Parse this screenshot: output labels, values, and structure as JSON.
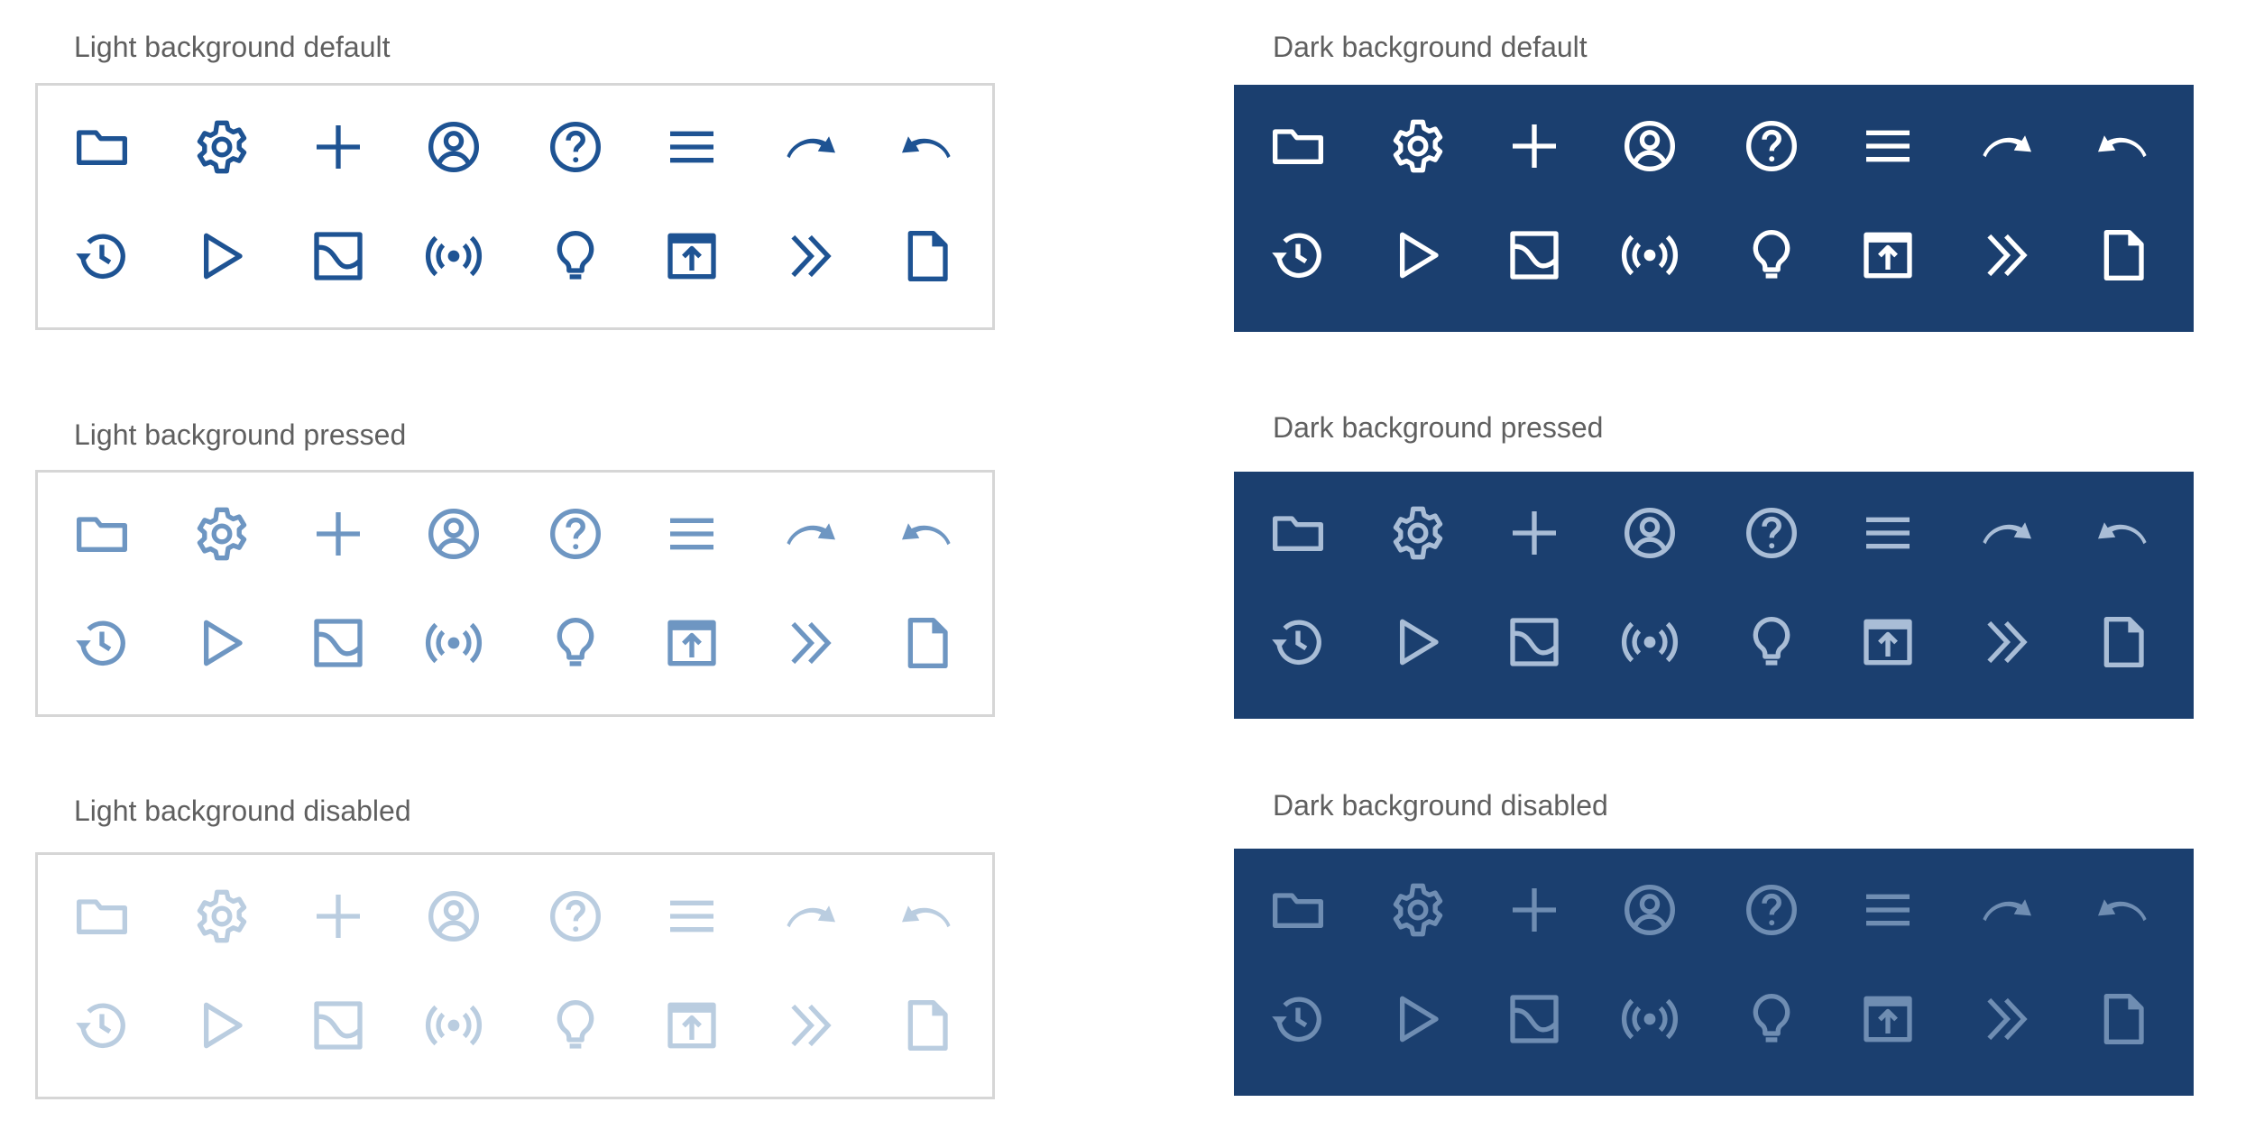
{
  "panels": [
    {
      "id": "light-default",
      "title": "Light background default",
      "theme": "light",
      "state": "default",
      "icon_color": "#1e5393"
    },
    {
      "id": "light-pressed",
      "title": "Light background pressed",
      "theme": "light",
      "state": "pressed",
      "icon_color": "#6e96c2"
    },
    {
      "id": "light-disabled",
      "title": "Light background disabled",
      "theme": "light",
      "state": "disabled",
      "icon_color": "#bacde0"
    },
    {
      "id": "dark-default",
      "title": "Dark background default",
      "theme": "dark",
      "state": "default",
      "icon_color": "#ffffff"
    },
    {
      "id": "dark-pressed",
      "title": "Dark background pressed",
      "theme": "dark",
      "state": "pressed",
      "icon_color": "#a9bdd6"
    },
    {
      "id": "dark-disabled",
      "title": "Dark background disabled",
      "theme": "dark",
      "state": "disabled",
      "icon_color": "#6f8db2"
    }
  ],
  "icons": [
    [
      "folder-icon",
      "gear-icon",
      "plus-icon",
      "user-circle-icon",
      "help-circle-icon",
      "menu-icon",
      "redo-icon",
      "undo-icon"
    ],
    [
      "history-icon",
      "play-icon",
      "image-icon",
      "broadcast-icon",
      "lightbulb-icon",
      "upload-window-icon",
      "chevron-double-right-icon",
      "document-icon"
    ]
  ],
  "colors": {
    "dark_panel_background": "#1b3f6f",
    "light_panel_border": "#d6d6d6",
    "title_text": "#5f5f5f"
  }
}
